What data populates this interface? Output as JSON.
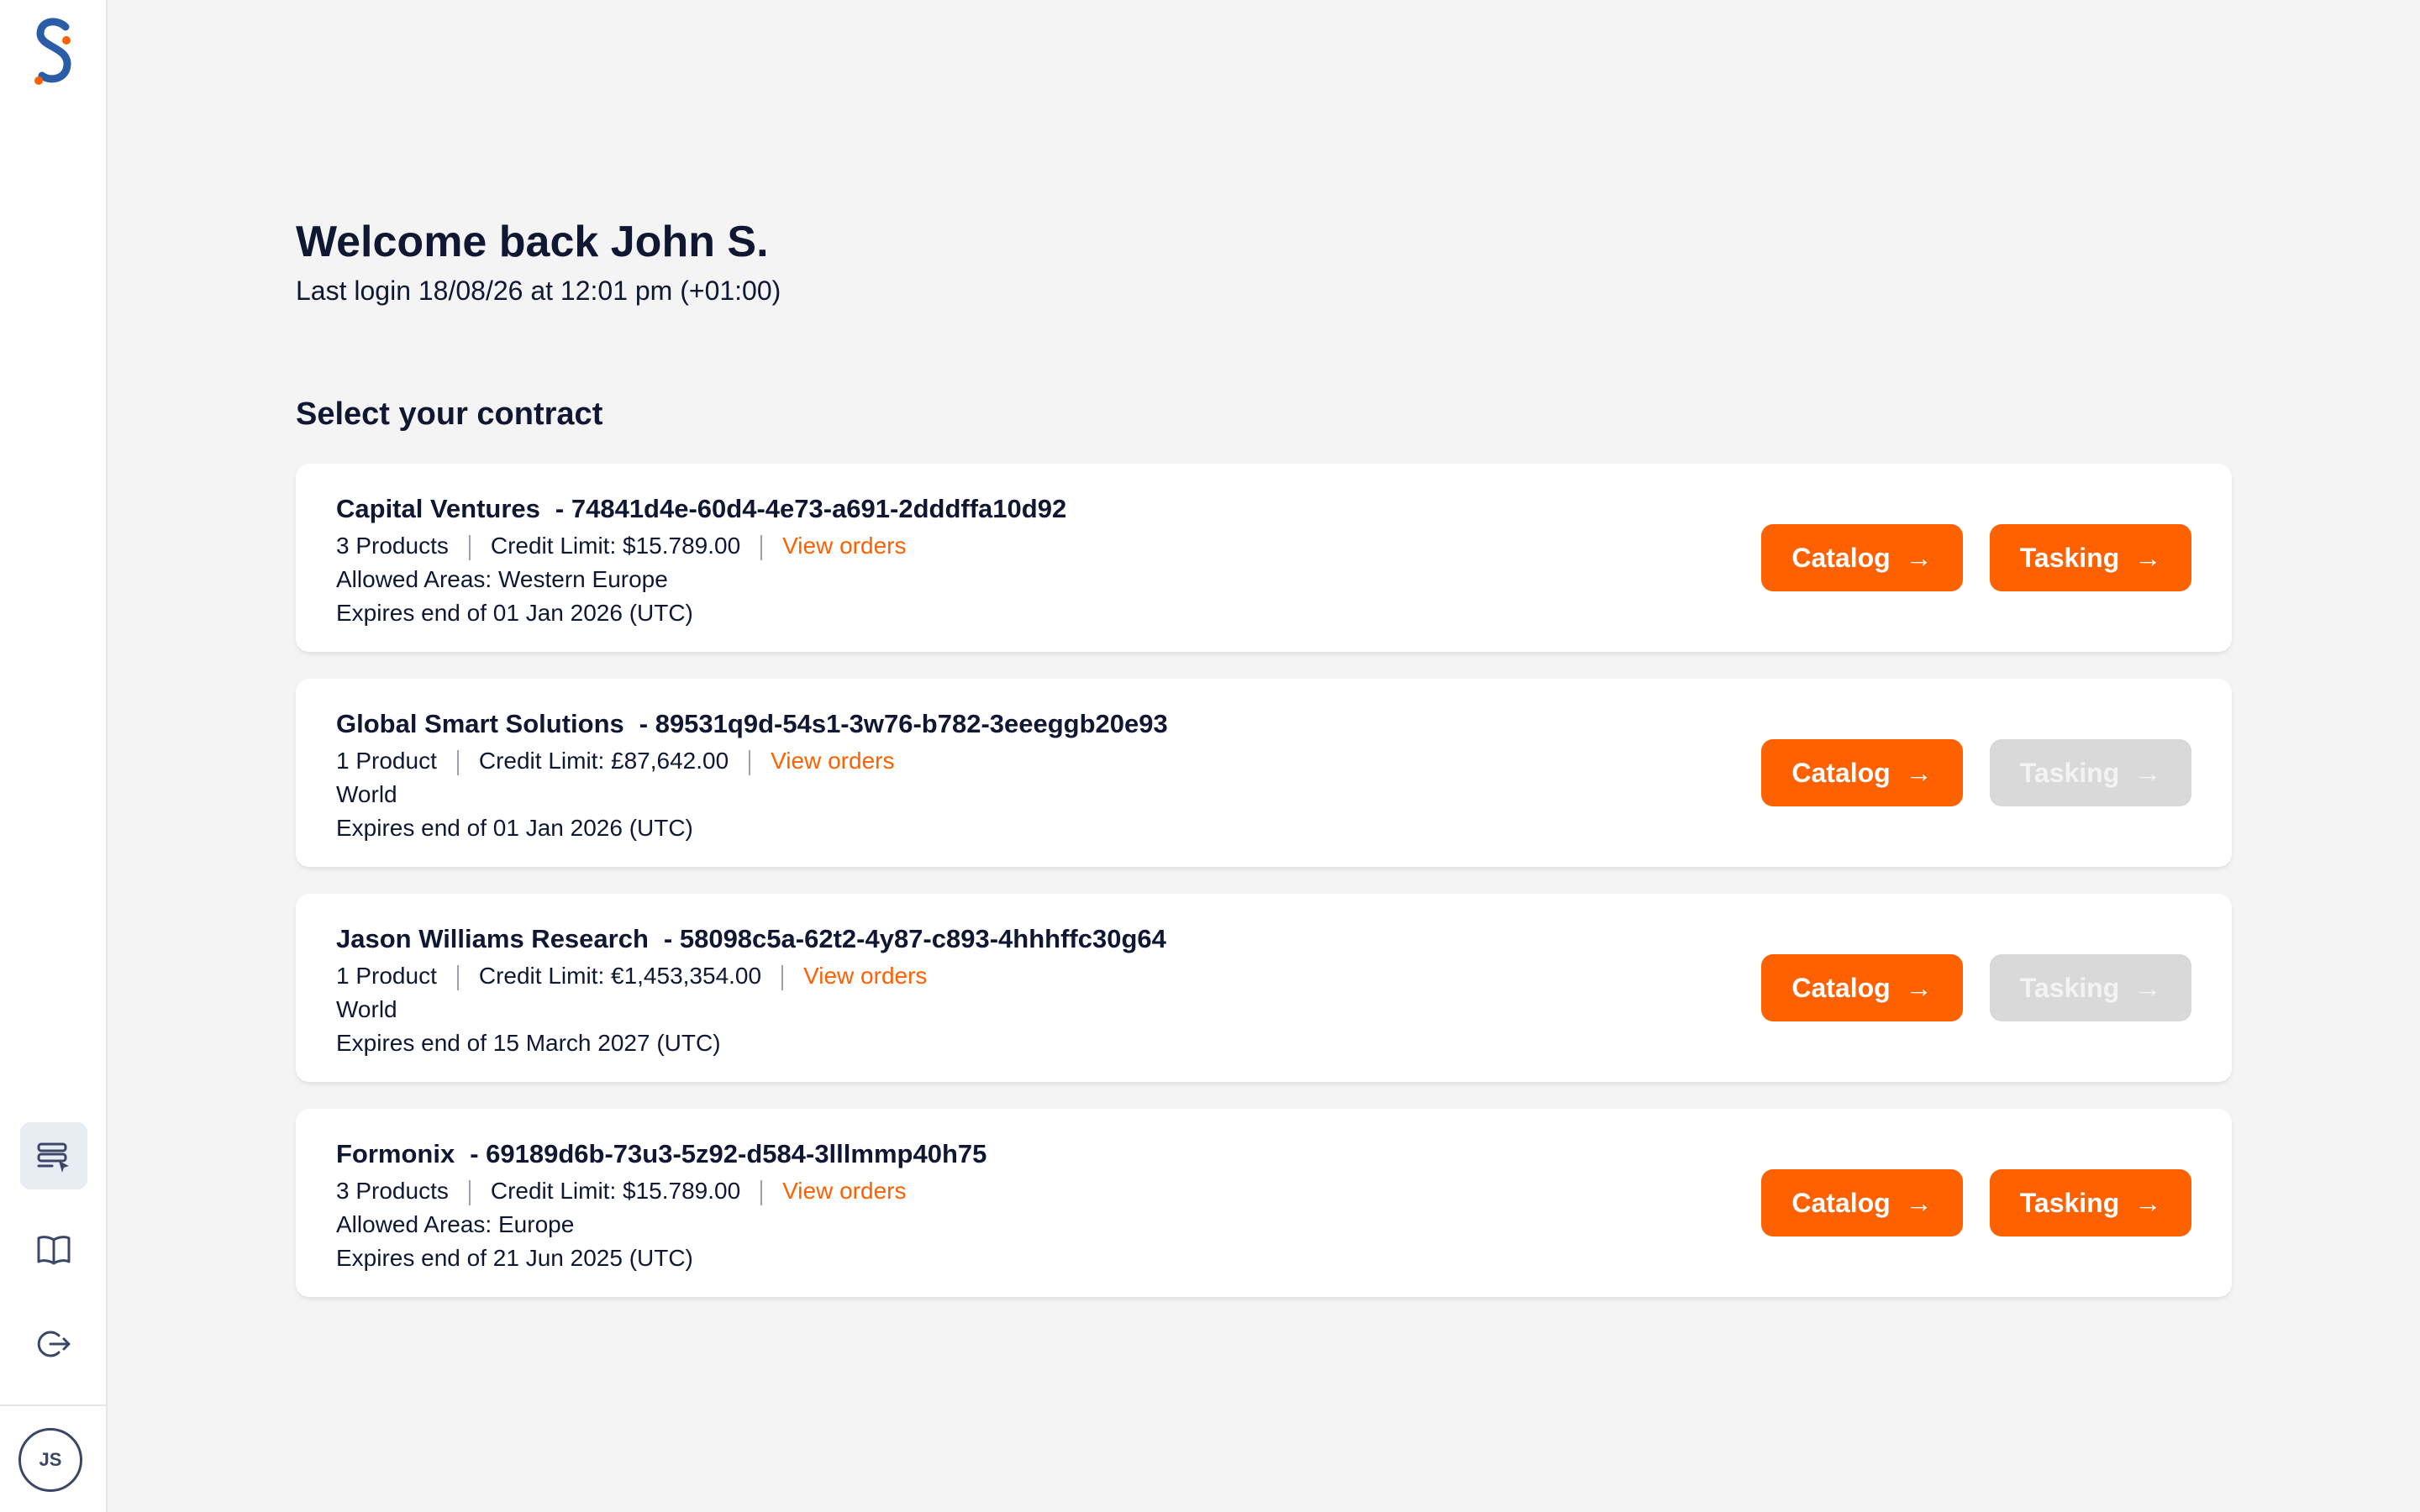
{
  "user": {
    "initials": "JS"
  },
  "header": {
    "welcome": "Welcome back John S.",
    "last_login": "Last login 18/08/26 at 12:01 pm (+01:00)"
  },
  "section_title": "Select your contract",
  "labels": {
    "catalog": "Catalog",
    "tasking": "Tasking",
    "view_orders": "View orders",
    "arrow": "→"
  },
  "icons": [
    "logo-icon",
    "contracts-icon",
    "book-icon",
    "logout-icon"
  ],
  "colors": {
    "accent": "#ff6000",
    "disabled": "#d9d9d9",
    "text": "#101733"
  },
  "contracts": [
    {
      "name": "Capital Ventures",
      "id": "- 74841d4e-60d4-4e73-a691-2dddffa10d92",
      "products": "3 Products",
      "credit": "Credit Limit: $15.789.00",
      "area": "Allowed Areas: Western Europe",
      "expires": "Expires end of 01 Jan 2026 (UTC)",
      "tasking_enabled": true
    },
    {
      "name": "Global Smart Solutions",
      "id": "- 89531q9d-54s1-3w76-b782-3eeeggb20e93",
      "products": "1 Product",
      "credit": "Credit Limit: £87,642.00",
      "area": "World",
      "expires": "Expires end of 01 Jan 2026 (UTC)",
      "tasking_enabled": false
    },
    {
      "name": "Jason Williams Research",
      "id": "- 58098c5a-62t2-4y87-c893-4hhhffc30g64",
      "products": "1 Product",
      "credit": "Credit Limit: €1,453,354.00",
      "area": "World",
      "expires": "Expires end of 15 March 2027 (UTC)",
      "tasking_enabled": false
    },
    {
      "name": "Formonix",
      "id": "- 69189d6b-73u3-5z92-d584-3lllmmp40h75",
      "products": "3 Products",
      "credit": "Credit Limit: $15.789.00",
      "area": "Allowed Areas: Europe",
      "expires": "Expires end of 21 Jun 2025 (UTC)",
      "tasking_enabled": true
    }
  ]
}
